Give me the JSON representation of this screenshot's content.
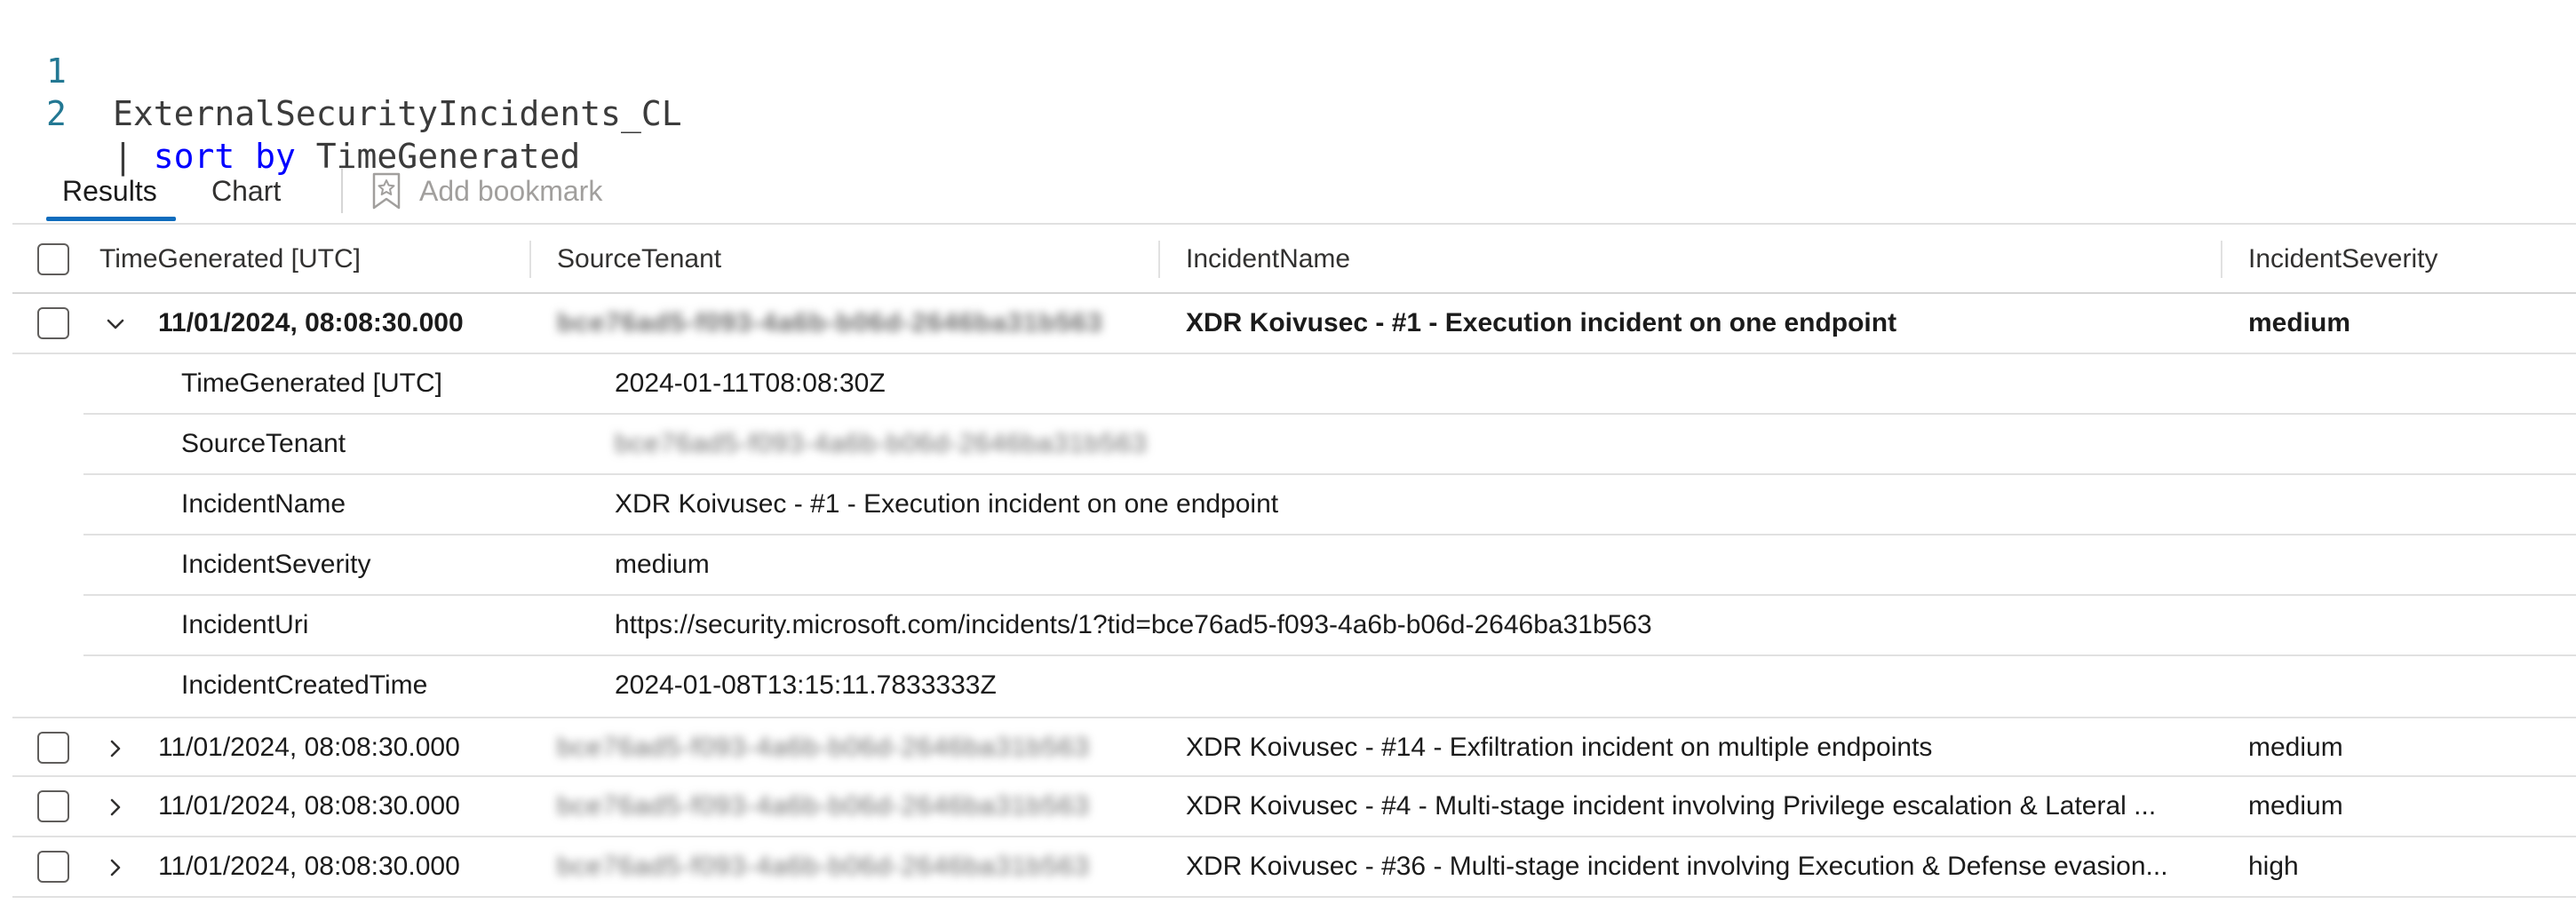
{
  "editor": {
    "lines": [
      {
        "num": "1",
        "text": "ExternalSecurityIncidents_CL"
      },
      {
        "num": "2",
        "pipe": "| ",
        "kw": "sort by",
        "rest": " TimeGenerated"
      }
    ]
  },
  "tabs": {
    "results": "Results",
    "chart": "Chart",
    "bookmark": "Add bookmark"
  },
  "columns": [
    "TimeGenerated [UTC]",
    "SourceTenant",
    "IncidentName",
    "IncidentSeverity"
  ],
  "rows": [
    {
      "time": "11/01/2024, 08:08:30.000",
      "tenant": "bce76ad5-f093-4a6b-b06d-2646ba31b563",
      "name": "XDR Koivusec - #1 - Execution incident on one endpoint",
      "severity": "medium",
      "expanded": true
    },
    {
      "time": "11/01/2024, 08:08:30.000",
      "tenant": "bce76ad5-f093-4a6b-b06d-2646ba31b563",
      "name": "XDR Koivusec - #14 - Exfiltration incident on multiple endpoints",
      "severity": "medium",
      "expanded": false
    },
    {
      "time": "11/01/2024, 08:08:30.000",
      "tenant": "bce76ad5-f093-4a6b-b06d-2646ba31b563",
      "name": "XDR Koivusec - #4 - Multi-stage incident involving Privilege escalation & Lateral ...",
      "severity": "medium",
      "expanded": false
    },
    {
      "time": "11/01/2024, 08:08:30.000",
      "tenant": "bce76ad5-f093-4a6b-b06d-2646ba31b563",
      "name": "XDR Koivusec - #36 - Multi-stage incident involving Execution & Defense evasion...",
      "severity": "high",
      "expanded": false
    }
  ],
  "details": [
    {
      "key": "TimeGenerated [UTC]",
      "value": "2024-01-11T08:08:30Z"
    },
    {
      "key": "SourceTenant",
      "value": "bce76ad5-f093-4a6b-b06d-2646ba31b563"
    },
    {
      "key": "IncidentName",
      "value": "XDR Koivusec - #1 - Execution incident on one endpoint"
    },
    {
      "key": "IncidentSeverity",
      "value": "medium"
    },
    {
      "key": "IncidentUri",
      "value": "https://security.microsoft.com/incidents/1?tid=bce76ad5-f093-4a6b-b06d-2646ba31b563"
    },
    {
      "key": "IncidentCreatedTime",
      "value": "2024-01-08T13:15:11.7833333Z"
    }
  ],
  "colors": {
    "accent": "#0f6cbd",
    "keyword": "#0000ff",
    "lineNumber": "#237893"
  }
}
